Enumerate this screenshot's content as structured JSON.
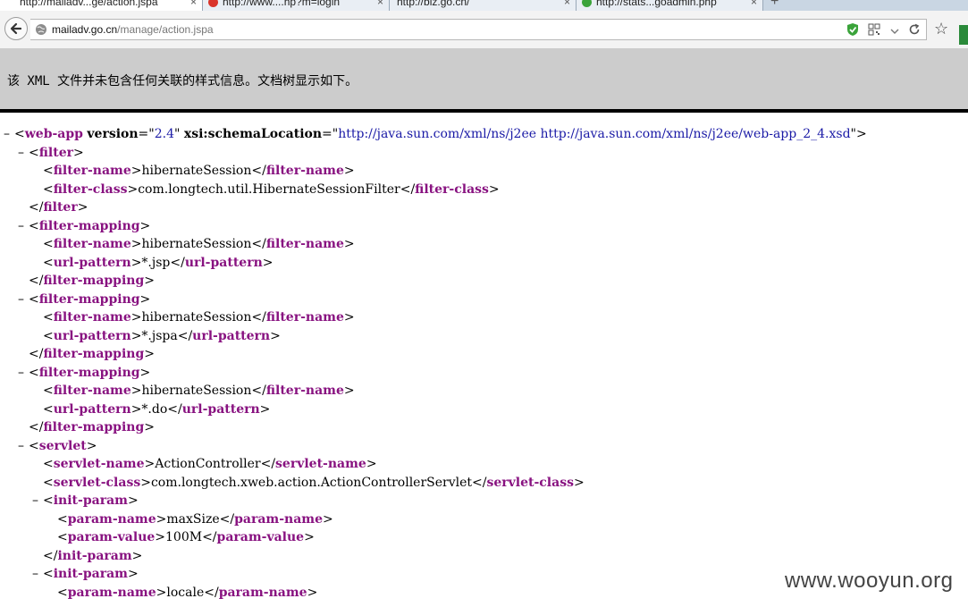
{
  "tabs": [
    {
      "title": "http://mailadv...ge/action.jspa",
      "active": true,
      "favicon_color": "#ffffff"
    },
    {
      "title": "http://www....hp?m=login",
      "active": false,
      "favicon_color": "#d9342b"
    },
    {
      "title": "http://biz.go.cn/",
      "active": false,
      "favicon_color": "#ffffff"
    },
    {
      "title": "http://stats...goadmin.php",
      "active": false,
      "favicon_color": "#3aa33a"
    }
  ],
  "address": {
    "host": "mailadv.go.cn",
    "path": "/manage/action.jspa"
  },
  "notice": "该 XML 文件并未包含任何关联的样式信息。文档树显示如下。",
  "xml_lines": [
    {
      "indent": 0,
      "toggle": "–",
      "parts": [
        [
          "p",
          "<"
        ],
        [
          "t",
          "web-app"
        ],
        [
          "p",
          " "
        ],
        [
          "a",
          "version"
        ],
        [
          "p",
          "=\""
        ],
        [
          "v",
          "2.4"
        ],
        [
          "p",
          "\" "
        ],
        [
          "a",
          "xsi:schemaLocation"
        ],
        [
          "p",
          "=\""
        ],
        [
          "v",
          "http://java.sun.com/xml/ns/j2ee http://java.sun.com/xml/ns/j2ee/web-app_2_4.xsd"
        ],
        [
          "p",
          "\">"
        ]
      ]
    },
    {
      "indent": 1,
      "toggle": "–",
      "parts": [
        [
          "p",
          "<"
        ],
        [
          "t",
          "filter"
        ],
        [
          "p",
          ">"
        ]
      ]
    },
    {
      "indent": 2,
      "toggle": "",
      "parts": [
        [
          "p",
          "<"
        ],
        [
          "t",
          "filter-name"
        ],
        [
          "p",
          ">"
        ],
        [
          "x",
          "hibernateSession"
        ],
        [
          "p",
          "</"
        ],
        [
          "t",
          "filter-name"
        ],
        [
          "p",
          ">"
        ]
      ]
    },
    {
      "indent": 2,
      "toggle": "",
      "parts": [
        [
          "p",
          "<"
        ],
        [
          "t",
          "filter-class"
        ],
        [
          "p",
          ">"
        ],
        [
          "x",
          "com.longtech.util.HibernateSessionFilter"
        ],
        [
          "p",
          "</"
        ],
        [
          "t",
          "filter-class"
        ],
        [
          "p",
          ">"
        ]
      ]
    },
    {
      "indent": 1,
      "toggle": "",
      "parts": [
        [
          "p",
          "</"
        ],
        [
          "t",
          "filter"
        ],
        [
          "p",
          ">"
        ]
      ]
    },
    {
      "indent": 1,
      "toggle": "–",
      "parts": [
        [
          "p",
          "<"
        ],
        [
          "t",
          "filter-mapping"
        ],
        [
          "p",
          ">"
        ]
      ]
    },
    {
      "indent": 2,
      "toggle": "",
      "parts": [
        [
          "p",
          "<"
        ],
        [
          "t",
          "filter-name"
        ],
        [
          "p",
          ">"
        ],
        [
          "x",
          "hibernateSession"
        ],
        [
          "p",
          "</"
        ],
        [
          "t",
          "filter-name"
        ],
        [
          "p",
          ">"
        ]
      ]
    },
    {
      "indent": 2,
      "toggle": "",
      "parts": [
        [
          "p",
          "<"
        ],
        [
          "t",
          "url-pattern"
        ],
        [
          "p",
          ">"
        ],
        [
          "x",
          "*.jsp"
        ],
        [
          "p",
          "</"
        ],
        [
          "t",
          "url-pattern"
        ],
        [
          "p",
          ">"
        ]
      ]
    },
    {
      "indent": 1,
      "toggle": "",
      "parts": [
        [
          "p",
          "</"
        ],
        [
          "t",
          "filter-mapping"
        ],
        [
          "p",
          ">"
        ]
      ]
    },
    {
      "indent": 1,
      "toggle": "–",
      "parts": [
        [
          "p",
          "<"
        ],
        [
          "t",
          "filter-mapping"
        ],
        [
          "p",
          ">"
        ]
      ]
    },
    {
      "indent": 2,
      "toggle": "",
      "parts": [
        [
          "p",
          "<"
        ],
        [
          "t",
          "filter-name"
        ],
        [
          "p",
          ">"
        ],
        [
          "x",
          "hibernateSession"
        ],
        [
          "p",
          "</"
        ],
        [
          "t",
          "filter-name"
        ],
        [
          "p",
          ">"
        ]
      ]
    },
    {
      "indent": 2,
      "toggle": "",
      "parts": [
        [
          "p",
          "<"
        ],
        [
          "t",
          "url-pattern"
        ],
        [
          "p",
          ">"
        ],
        [
          "x",
          "*.jspa"
        ],
        [
          "p",
          "</"
        ],
        [
          "t",
          "url-pattern"
        ],
        [
          "p",
          ">"
        ]
      ]
    },
    {
      "indent": 1,
      "toggle": "",
      "parts": [
        [
          "p",
          "</"
        ],
        [
          "t",
          "filter-mapping"
        ],
        [
          "p",
          ">"
        ]
      ]
    },
    {
      "indent": 1,
      "toggle": "–",
      "parts": [
        [
          "p",
          "<"
        ],
        [
          "t",
          "filter-mapping"
        ],
        [
          "p",
          ">"
        ]
      ]
    },
    {
      "indent": 2,
      "toggle": "",
      "parts": [
        [
          "p",
          "<"
        ],
        [
          "t",
          "filter-name"
        ],
        [
          "p",
          ">"
        ],
        [
          "x",
          "hibernateSession"
        ],
        [
          "p",
          "</"
        ],
        [
          "t",
          "filter-name"
        ],
        [
          "p",
          ">"
        ]
      ]
    },
    {
      "indent": 2,
      "toggle": "",
      "parts": [
        [
          "p",
          "<"
        ],
        [
          "t",
          "url-pattern"
        ],
        [
          "p",
          ">"
        ],
        [
          "x",
          "*.do"
        ],
        [
          "p",
          "</"
        ],
        [
          "t",
          "url-pattern"
        ],
        [
          "p",
          ">"
        ]
      ]
    },
    {
      "indent": 1,
      "toggle": "",
      "parts": [
        [
          "p",
          "</"
        ],
        [
          "t",
          "filter-mapping"
        ],
        [
          "p",
          ">"
        ]
      ]
    },
    {
      "indent": 1,
      "toggle": "–",
      "parts": [
        [
          "p",
          "<"
        ],
        [
          "t",
          "servlet"
        ],
        [
          "p",
          ">"
        ]
      ]
    },
    {
      "indent": 2,
      "toggle": "",
      "parts": [
        [
          "p",
          "<"
        ],
        [
          "t",
          "servlet-name"
        ],
        [
          "p",
          ">"
        ],
        [
          "x",
          "ActionController"
        ],
        [
          "p",
          "</"
        ],
        [
          "t",
          "servlet-name"
        ],
        [
          "p",
          ">"
        ]
      ]
    },
    {
      "indent": 2,
      "toggle": "",
      "parts": [
        [
          "p",
          "<"
        ],
        [
          "t",
          "servlet-class"
        ],
        [
          "p",
          ">"
        ],
        [
          "x",
          "com.longtech.xweb.action.ActionControllerServlet"
        ],
        [
          "p",
          "</"
        ],
        [
          "t",
          "servlet-class"
        ],
        [
          "p",
          ">"
        ]
      ]
    },
    {
      "indent": 2,
      "toggle": "–",
      "parts": [
        [
          "p",
          "<"
        ],
        [
          "t",
          "init-param"
        ],
        [
          "p",
          ">"
        ]
      ]
    },
    {
      "indent": 3,
      "toggle": "",
      "parts": [
        [
          "p",
          "<"
        ],
        [
          "t",
          "param-name"
        ],
        [
          "p",
          ">"
        ],
        [
          "x",
          "maxSize"
        ],
        [
          "p",
          "</"
        ],
        [
          "t",
          "param-name"
        ],
        [
          "p",
          ">"
        ]
      ]
    },
    {
      "indent": 3,
      "toggle": "",
      "parts": [
        [
          "p",
          "<"
        ],
        [
          "t",
          "param-value"
        ],
        [
          "p",
          ">"
        ],
        [
          "x",
          "100M"
        ],
        [
          "p",
          "</"
        ],
        [
          "t",
          "param-value"
        ],
        [
          "p",
          ">"
        ]
      ]
    },
    {
      "indent": 2,
      "toggle": "",
      "parts": [
        [
          "p",
          "</"
        ],
        [
          "t",
          "init-param"
        ],
        [
          "p",
          ">"
        ]
      ]
    },
    {
      "indent": 2,
      "toggle": "–",
      "parts": [
        [
          "p",
          "<"
        ],
        [
          "t",
          "init-param"
        ],
        [
          "p",
          ">"
        ]
      ]
    },
    {
      "indent": 3,
      "toggle": "",
      "parts": [
        [
          "p",
          "<"
        ],
        [
          "t",
          "param-name"
        ],
        [
          "p",
          ">"
        ],
        [
          "x",
          "locale"
        ],
        [
          "p",
          "</"
        ],
        [
          "t",
          "param-name"
        ],
        [
          "p",
          ">"
        ]
      ]
    }
  ],
  "watermark": "www.wooyun.org"
}
